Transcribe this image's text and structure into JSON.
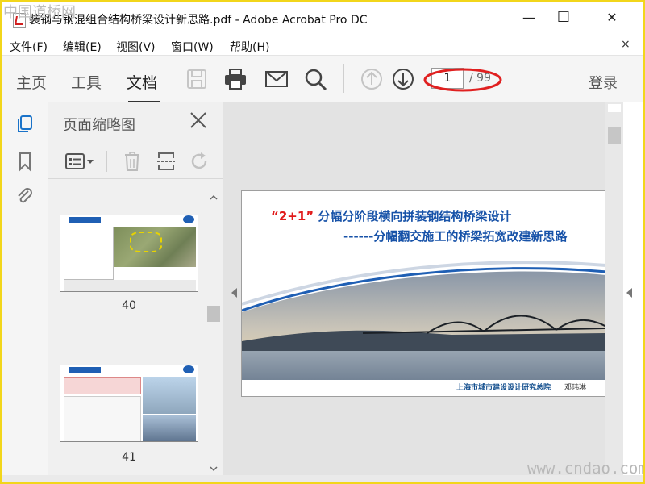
{
  "window": {
    "title": "装钢与钢混组合结构桥梁设计新思路.pdf - Adobe Acrobat Pro DC",
    "minimize": "—",
    "maximize": "☐",
    "close": "✕"
  },
  "menu": {
    "items": [
      {
        "label": "文件(F)"
      },
      {
        "label": "编辑(E)"
      },
      {
        "label": "视图(V)"
      },
      {
        "label": "窗口(W)"
      },
      {
        "label": "帮助(H)"
      }
    ],
    "close": "×"
  },
  "toolbar": {
    "tabs": [
      {
        "label": "主页"
      },
      {
        "label": "工具"
      },
      {
        "label": "文档",
        "active": true
      }
    ],
    "icons": [
      "save-icon",
      "print-icon",
      "mail-icon",
      "search-icon",
      "page-up-icon",
      "page-down-icon"
    ],
    "current_page": "1",
    "total_pages": "/ 99",
    "login": "登录",
    "highlight_color": "#e02020"
  },
  "sidebar": {
    "icons": [
      "page-thumbnails-icon",
      "bookmark-icon",
      "attachment-icon"
    ]
  },
  "thumbnails_panel": {
    "title": "页面缩略图",
    "tools": [
      "options-menu-icon",
      "delete-icon",
      "insert-page-icon",
      "rotate-icon"
    ],
    "pages": [
      {
        "label": "40",
        "header": "全桥 | 周边环境情况"
      },
      {
        "label": "41",
        "header": "全桥 | 工程施工方案"
      }
    ]
  },
  "slide": {
    "title_em": "“2+1”",
    "title_rest": "分幅分阶段横向拼装钢结构桥梁设计",
    "subtitle": "------分幅翻交施工的桥梁拓宽改建新思路",
    "footer_org": "上海市城市建设设计研究总院",
    "footer_author": "邓玮琳"
  },
  "watermarks": {
    "top_left": "中国道桥网",
    "bottom_right": "www.cndao.com"
  }
}
